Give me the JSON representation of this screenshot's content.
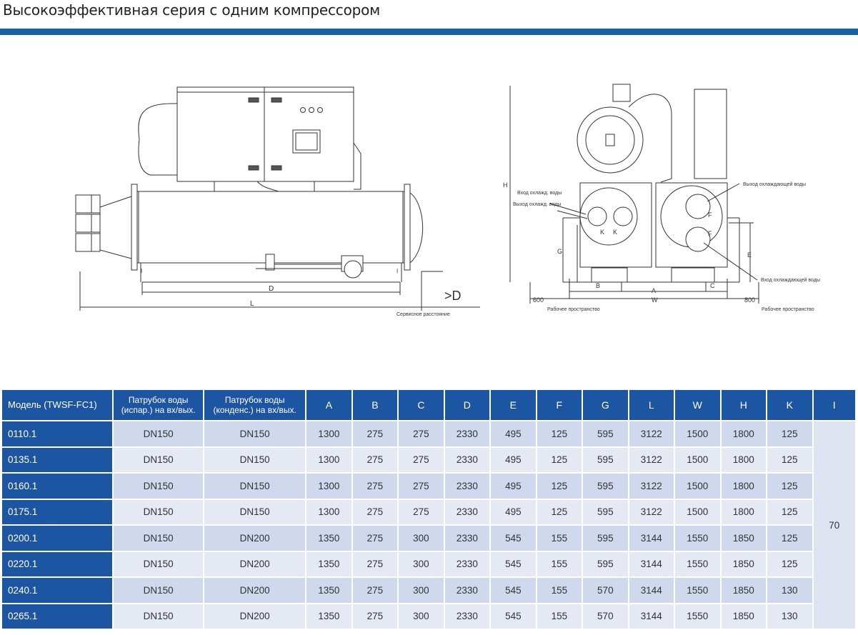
{
  "title": "Высокоэффективная серия с одним компрессором",
  "drawing": {
    "front": {
      "dim_D": "D",
      "dim_L": "L",
      "service_gap": ">D",
      "service_label": "Сервисное расстояние",
      "mark_I": "I"
    },
    "side": {
      "evap_in": "Вход охлажд. воды",
      "evap_out": "Выход охлажд. воды",
      "cond_out": "Выход охлаждающей воды",
      "cond_in": "Вход охлаждающей воды",
      "dim_H": "H",
      "dim_G": "G",
      "dim_E": "E",
      "dim_F": "F",
      "dim_K": "K",
      "dim_A": "A",
      "dim_B": "B",
      "dim_C": "C",
      "dim_W": "W",
      "left_clear": "600",
      "right_clear": "800",
      "work_space": "Рабочее пространство"
    }
  },
  "table": {
    "headers": [
      "Модель (TWSF-FC1)",
      "Патрубок воды (испар.) на вх/вых.",
      "Патрубок воды (конденс.) на вх/вых.",
      "A",
      "B",
      "C",
      "D",
      "E",
      "F",
      "G",
      "L",
      "W",
      "H",
      "K",
      "I"
    ],
    "rows": [
      [
        "0110.1",
        "DN150",
        "DN150",
        "1300",
        "275",
        "275",
        "2330",
        "495",
        "125",
        "595",
        "3122",
        "1500",
        "1800",
        "125"
      ],
      [
        "0135.1",
        "DN150",
        "DN150",
        "1300",
        "275",
        "275",
        "2330",
        "495",
        "125",
        "595",
        "3122",
        "1500",
        "1800",
        "125"
      ],
      [
        "0160.1",
        "DN150",
        "DN150",
        "1300",
        "275",
        "275",
        "2330",
        "495",
        "125",
        "595",
        "3122",
        "1500",
        "1800",
        "125"
      ],
      [
        "0175.1",
        "DN150",
        "DN150",
        "1300",
        "275",
        "275",
        "2330",
        "495",
        "125",
        "595",
        "3122",
        "1500",
        "1800",
        "125"
      ],
      [
        "0200.1",
        "DN150",
        "DN200",
        "1350",
        "275",
        "300",
        "2330",
        "545",
        "155",
        "595",
        "3144",
        "1550",
        "1850",
        "125"
      ],
      [
        "0220.1",
        "DN150",
        "DN200",
        "1350",
        "275",
        "300",
        "2330",
        "545",
        "155",
        "595",
        "3144",
        "1550",
        "1850",
        "125"
      ],
      [
        "0240.1",
        "DN150",
        "DN200",
        "1350",
        "275",
        "300",
        "2330",
        "545",
        "155",
        "570",
        "3144",
        "1550",
        "1850",
        "130"
      ],
      [
        "0265.1",
        "DN150",
        "DN200",
        "1350",
        "275",
        "300",
        "2330",
        "545",
        "155",
        "570",
        "3144",
        "1550",
        "1850",
        "130"
      ]
    ],
    "i_value": "70"
  }
}
